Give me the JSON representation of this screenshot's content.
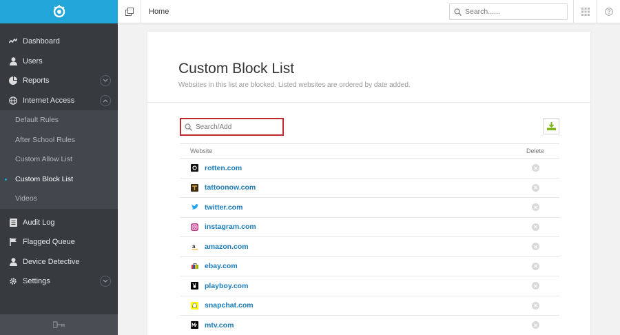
{
  "topbar": {
    "breadcrumb": "Home",
    "search_placeholder": "Search......"
  },
  "sidebar": {
    "items": [
      {
        "label": "Dashboard",
        "icon": "activity-icon"
      },
      {
        "label": "Users",
        "icon": "user-icon"
      },
      {
        "label": "Reports",
        "icon": "pie-chart-icon",
        "expander": "chevron-down"
      },
      {
        "label": "Internet Access",
        "icon": "globe-icon",
        "expander": "chevron-up"
      }
    ],
    "sub_items": [
      {
        "label": "Default Rules"
      },
      {
        "label": "After School Rules"
      },
      {
        "label": "Custom Allow List"
      },
      {
        "label": "Custom Block List",
        "active": true
      },
      {
        "label": "Videos"
      }
    ],
    "items2": [
      {
        "label": "Audit Log",
        "icon": "list-icon"
      },
      {
        "label": "Flagged Queue",
        "icon": "flag-icon"
      },
      {
        "label": "Device Detective",
        "icon": "user-icon"
      },
      {
        "label": "Settings",
        "icon": "gear-icon",
        "expander": "chevron-down"
      }
    ]
  },
  "main": {
    "title": "Custom Block List",
    "subtitle": "Websites in this list are blocked. Listed websites are ordered by date added.",
    "search_placeholder": "Search/Add",
    "table": {
      "columns": [
        "Website",
        "Delete"
      ],
      "rows": [
        {
          "site": "rotten.com",
          "icon_color": "#111111"
        },
        {
          "site": "tattoonow.com",
          "icon_color": "#3a2a12"
        },
        {
          "site": "twitter.com",
          "icon_color": "#1da1f2"
        },
        {
          "site": "instagram.com",
          "icon_color": "#c13584"
        },
        {
          "site": "amazon.com",
          "icon_color": "#222222"
        },
        {
          "site": "ebay.com",
          "icon_color": "#e53238"
        },
        {
          "site": "playboy.com",
          "icon_color": "#000000"
        },
        {
          "site": "snapchat.com",
          "icon_color": "#fffc00"
        },
        {
          "site": "mtv.com",
          "icon_color": "#000000"
        }
      ]
    }
  },
  "colors": {
    "accent": "#22a5d9",
    "sidebar": "#373b40",
    "link": "#1a7bb9",
    "highlight_border": "#c0282d",
    "download_green": "#7cb518"
  }
}
